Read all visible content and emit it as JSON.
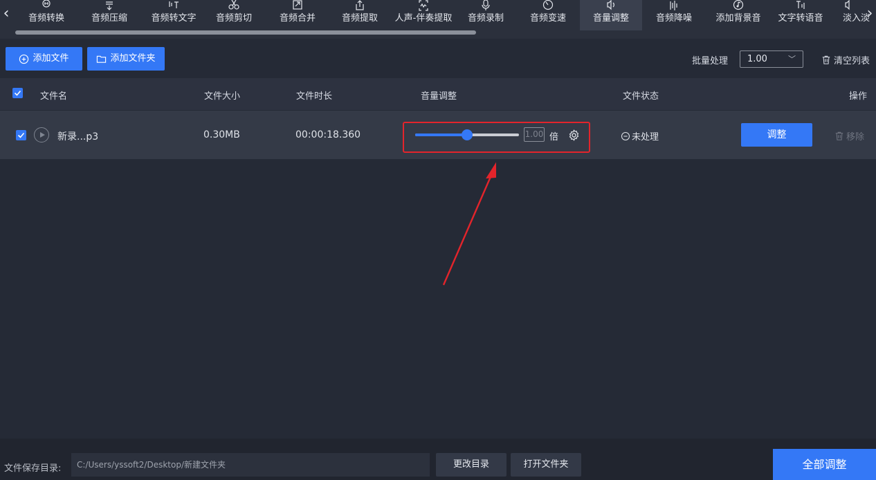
{
  "toolbar": {
    "tools": [
      {
        "label": "音频转换",
        "icon": "audio-convert-icon"
      },
      {
        "label": "音频压缩",
        "icon": "compress-icon"
      },
      {
        "label": "音频转文字",
        "icon": "speech-to-text-icon"
      },
      {
        "label": "音频剪切",
        "icon": "scissors-icon"
      },
      {
        "label": "音频合并",
        "icon": "merge-icon"
      },
      {
        "label": "音频提取",
        "icon": "extract-icon"
      },
      {
        "label": "人声-伴奏提取",
        "icon": "vocal-extract-icon"
      },
      {
        "label": "音频录制",
        "icon": "microphone-icon"
      },
      {
        "label": "音频变速",
        "icon": "speed-icon"
      },
      {
        "label": "音量调整",
        "icon": "volume-icon"
      },
      {
        "label": "音频降噪",
        "icon": "denoise-icon"
      },
      {
        "label": "添加背景音",
        "icon": "music-note-icon"
      },
      {
        "label": "文字转语音",
        "icon": "text-to-speech-icon"
      },
      {
        "label": "淡入淡",
        "icon": "fade-icon"
      }
    ],
    "active_tool": "音量调整"
  },
  "actions": {
    "add_file": "添加文件",
    "add_folder": "添加文件夹",
    "batch_label": "批量处理",
    "batch_value": "1.00",
    "clear_list": "清空列表"
  },
  "table": {
    "headers": {
      "name": "文件名",
      "size": "文件大小",
      "duration": "文件时长",
      "volume": "音量调整",
      "status": "文件状态",
      "action": "操作"
    },
    "rows": [
      {
        "checked": true,
        "name": "新录...p3",
        "size": "0.30MB",
        "duration": "00:00:18.360",
        "volume_value": "1.00",
        "volume_level": 0.5,
        "volume_unit": "倍",
        "status": "未处理",
        "adjust_button": "调整",
        "remove_button": "移除"
      }
    ]
  },
  "footer": {
    "save_label": "文件保存目录:",
    "save_path": "C:/Users/yssoft2/Desktop/新建文件夹",
    "change_dir": "更改目录",
    "open_folder": "打开文件夹",
    "adjust_all": "全部调整"
  },
  "colors": {
    "accent": "#3478f6",
    "highlight": "#e3242b",
    "background": "#252a36"
  }
}
